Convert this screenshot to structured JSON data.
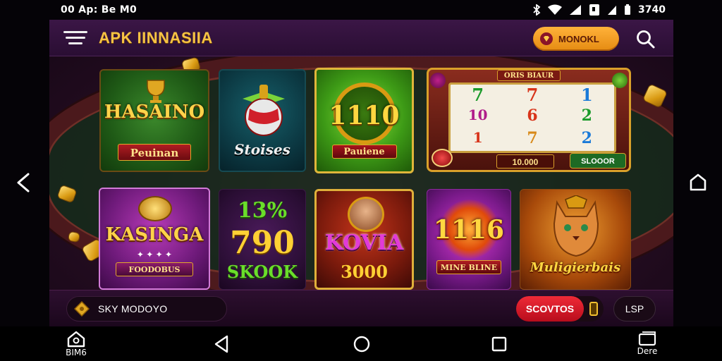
{
  "status_bar": {
    "time": "00 Ap: Be M0",
    "battery_text": "3740",
    "icons": [
      "bluetooth-icon",
      "wifi-icon",
      "signal-icon",
      "battery-icon"
    ]
  },
  "header": {
    "title": "APK IINNASIIA",
    "pill_label": "MONOKL",
    "menu_icon": "hamburger-menu-icon",
    "search_icon": "search-icon"
  },
  "games": [
    {
      "title": "HASAINO",
      "subtitle": "Peuinan"
    },
    {
      "title": "Stoises"
    },
    {
      "title": "1110",
      "subtitle": "Pauiene"
    },
    {
      "title": "slot-machine",
      "symbols": [
        "7",
        "7",
        "1",
        "10",
        "6",
        "2",
        "1",
        "7",
        "2"
      ],
      "left_readout": "10.000",
      "right_readout": "SLOOOR",
      "banner": "ORIS BIAUR"
    },
    {
      "title": "KASINGA",
      "subtitle": "FOODOBUS"
    },
    {
      "title": "13%",
      "line2": "790",
      "line3": "SKOOK"
    },
    {
      "title": "KOVIA",
      "subtitle": "3000"
    },
    {
      "title": "1116",
      "subtitle": "MINE BLINE"
    },
    {
      "title": "Muligierbais"
    }
  ],
  "bottom_bar": {
    "mode_label": "SKY MODOYO",
    "bonus_label": "SCOVTOS",
    "right_label": "LSP"
  },
  "nav": {
    "left_label": "BIM6",
    "right_label": "Dere"
  },
  "colors": {
    "accent_gold": "#f6c344",
    "header_bg": "#2a0e33",
    "pill_orange": "#ffb23a",
    "bonus_red": "#ef2a37"
  }
}
